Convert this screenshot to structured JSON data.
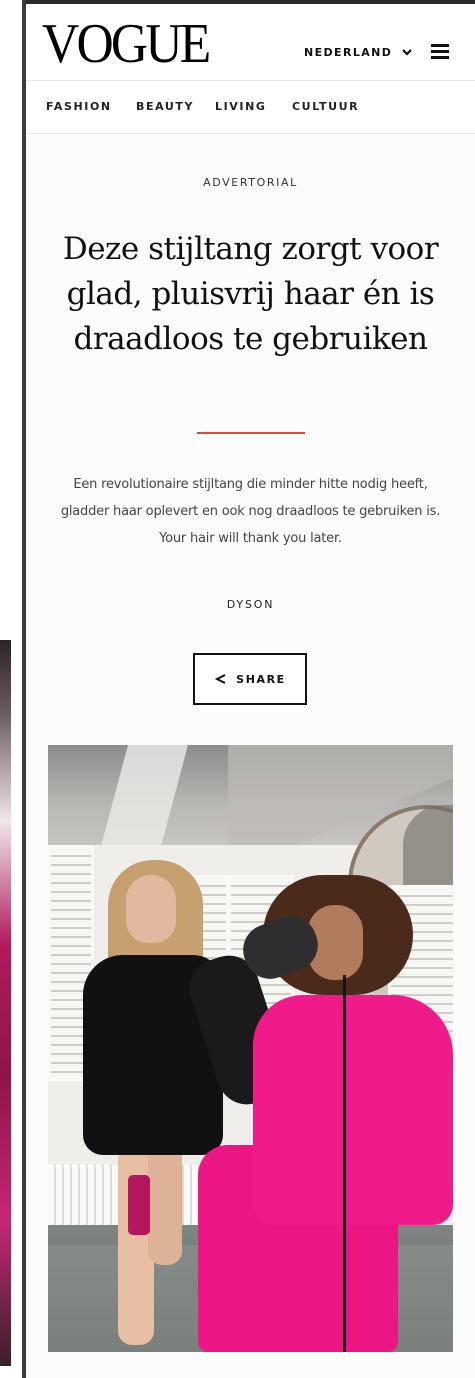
{
  "header": {
    "logo": "VOGUE",
    "region": "NEDERLAND",
    "region_icon": "chevron-down-icon",
    "menu_icon": "hamburger-menu-icon"
  },
  "nav": {
    "items": [
      {
        "label": "FASHION"
      },
      {
        "label": "BEAUTY"
      },
      {
        "label": "LIVING"
      },
      {
        "label": "CULTUUR"
      }
    ]
  },
  "article": {
    "category": "ADVERTORIAL",
    "headline": "Deze stijltang zorgt voor glad, pluisvrij haar én is draadloos te gebruiken",
    "dek": "Een revolutionaire stijltang die minder hitte nodig heeft, gladder haar oplevert en ook nog draadloos te gebruiken is. Your hair will thank you later.",
    "byline": "DYSON",
    "share_label": "SHARE",
    "share_icon": "share-icon"
  },
  "colors": {
    "accent_rule": "#e8423f",
    "text": "#111111",
    "suit_pink": "#f01b8a"
  }
}
